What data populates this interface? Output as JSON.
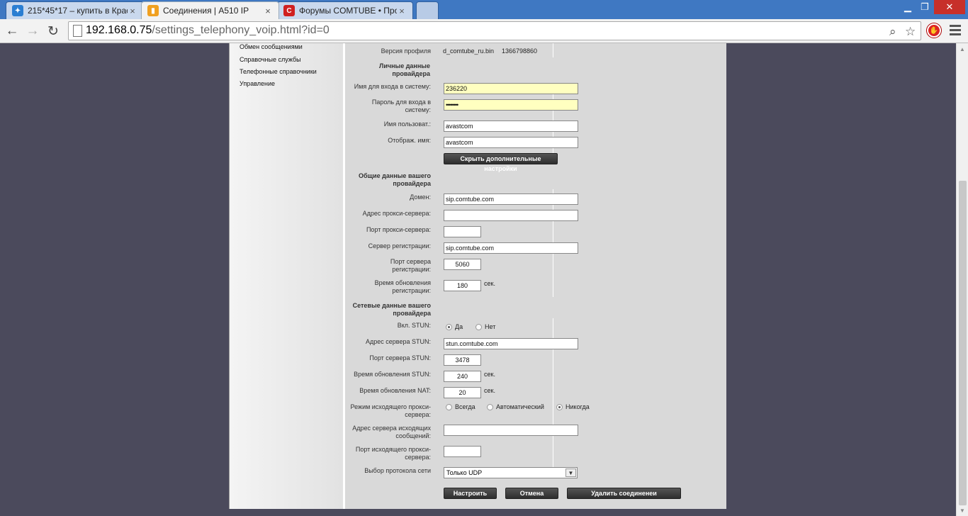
{
  "browser": {
    "tabs": [
      {
        "title": "215*45*17 – купить в Крас",
        "favicon": "globe-icon",
        "favicon_color": "#2a7ed2"
      },
      {
        "title": "Соединения | A510 IP",
        "favicon": "siemens-icon",
        "favicon_color": "#f0a020"
      },
      {
        "title": "Форумы COMTUBE • Про",
        "favicon": "comtube-icon",
        "favicon_color": "#d02020"
      }
    ],
    "close_glyph": "×",
    "url_host": "192.168.0.75",
    "url_path": "/settings_telephony_voip.html?id=0"
  },
  "sidebar": {
    "items": [
      "Обмен сообщениями",
      "Справочные службы",
      "Телефонные справочники",
      "Управление"
    ]
  },
  "form": {
    "profile_version_label": "Версия профиля",
    "profile_version_file": "d_comtube_ru.bin",
    "profile_version_num": "1366798860",
    "personal_header": "Личные данные провайдера",
    "login_label": "Имя для входа в систему:",
    "login_value": "236220",
    "password_label": "Пароль для входа в систему:",
    "password_value": "••••••••",
    "username_label": "Имя пользоват.:",
    "username_value": "avastcom",
    "display_label": "Отображ. имя:",
    "display_value": "avastcom",
    "hide_advanced_btn": "Скрыть дополнительные настройки",
    "general_header": "Общие данные вашего провайдера",
    "domain_label": "Домен:",
    "domain_value": "sip.comtube.com",
    "proxy_addr_label": "Адрес прокси-сервера:",
    "proxy_addr_value": "",
    "proxy_port_label": "Порт прокси-сервера:",
    "proxy_port_value": "",
    "reg_server_label": "Сервер регистрации:",
    "reg_server_value": "sip.comtube.com",
    "reg_port_label": "Порт сервера регистрации:",
    "reg_port_value": "5060",
    "reg_refresh_label": "Время обновления регистрации:",
    "reg_refresh_value": "180",
    "unit_sec": "сек.",
    "network_header": "Сетевые данные вашего провайдера",
    "stun_enable_label": "Вкл. STUN:",
    "stun_yes": "Да",
    "stun_no": "Нет",
    "stun_addr_label": "Адрес сервера STUN:",
    "stun_addr_value": "stun.comtube.com",
    "stun_port_label": "Порт сервера STUN:",
    "stun_port_value": "3478",
    "stun_refresh_label": "Время обновления STUN:",
    "stun_refresh_value": "240",
    "nat_refresh_label": "Время обновления NAT:",
    "nat_refresh_value": "20",
    "outbound_mode_label": "Режим исходящего прокси-сервера:",
    "mode_always": "Всегда",
    "mode_auto": "Автоматический",
    "mode_never": "Никогда",
    "outbound_addr_label": "Адрес сервера исходящих сообщений:",
    "outbound_addr_value": "",
    "outbound_port_label": "Порт исходящего прокси-сервера:",
    "outbound_port_value": "",
    "protocol_label": "Выбор протокола сети",
    "protocol_value": "Только UDP",
    "btn_configure": "Настроить",
    "btn_cancel": "Отмена",
    "btn_delete": "Удалить соединенеи"
  }
}
